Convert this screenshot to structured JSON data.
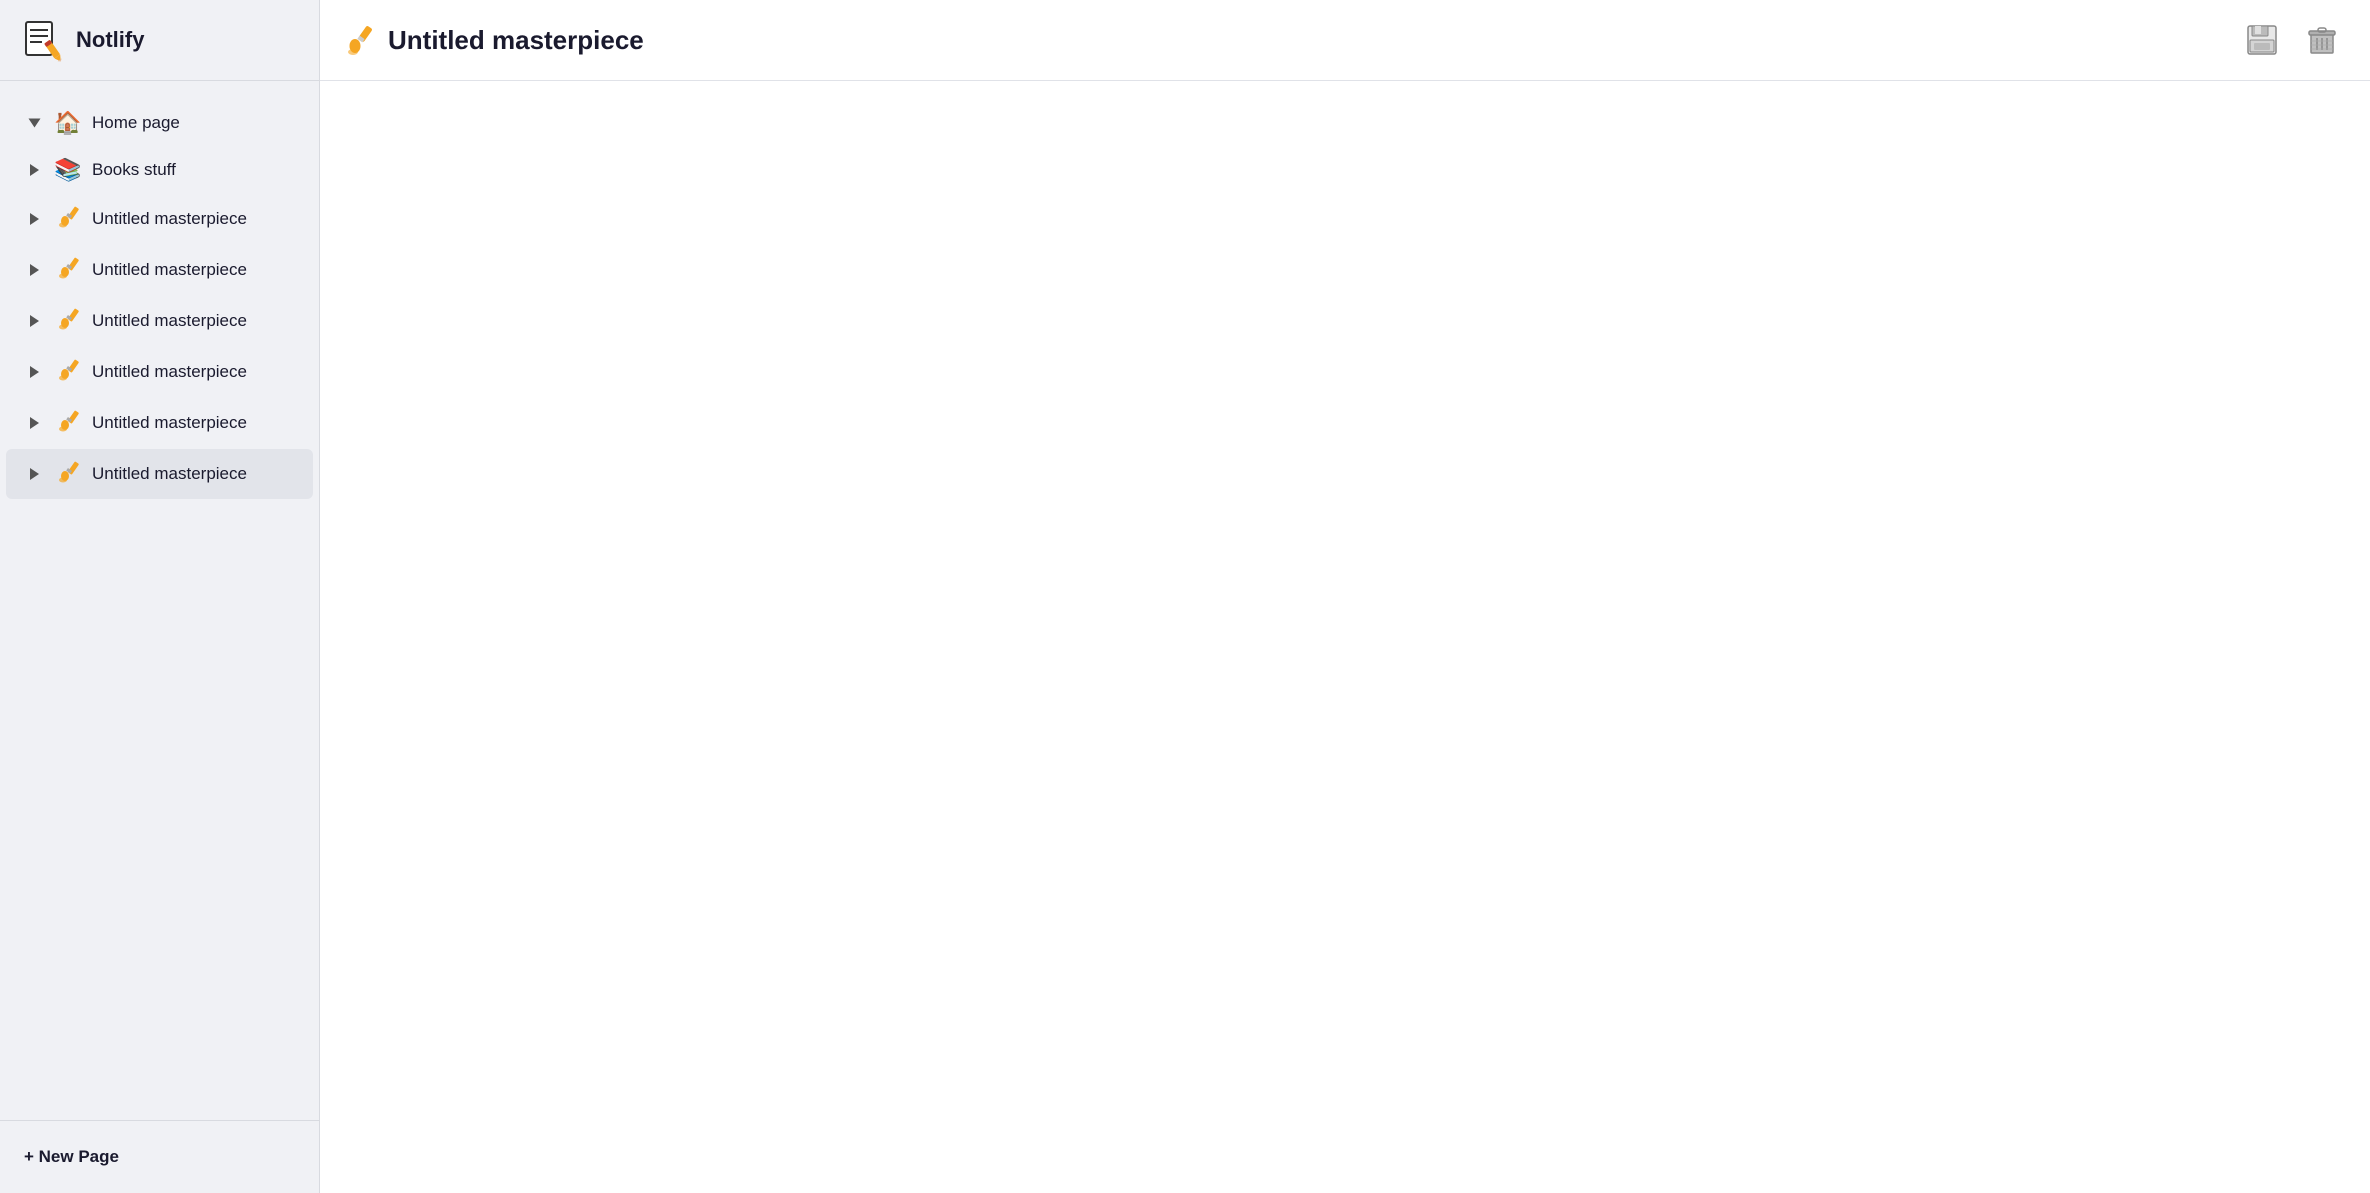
{
  "app": {
    "title": "Notlify",
    "logo_alt": "notlify-logo"
  },
  "sidebar": {
    "nav_items": [
      {
        "id": "home",
        "label": "Home page",
        "icon": "🏠",
        "expanded": true,
        "active": false
      },
      {
        "id": "books",
        "label": "Books stuff",
        "icon": "📚",
        "expanded": false,
        "active": false
      },
      {
        "id": "untitled1",
        "label": "Untitled masterpiece",
        "icon": "🖌️",
        "expanded": false,
        "active": false
      },
      {
        "id": "untitled2",
        "label": "Untitled masterpiece",
        "icon": "🖌️",
        "expanded": false,
        "active": false
      },
      {
        "id": "untitled3",
        "label": "Untitled masterpiece",
        "icon": "🖌️",
        "expanded": false,
        "active": false
      },
      {
        "id": "untitled4",
        "label": "Untitled masterpiece",
        "icon": "🖌️",
        "expanded": false,
        "active": false
      },
      {
        "id": "untitled5",
        "label": "Untitled masterpiece",
        "icon": "🖌️",
        "expanded": false,
        "active": false
      },
      {
        "id": "untitled6",
        "label": "Untitled masterpiece",
        "icon": "🖌️",
        "expanded": false,
        "active": true
      }
    ],
    "new_page_label": "+ New Page"
  },
  "main": {
    "title": "Untitled masterpiece",
    "title_icon": "🖌️",
    "save_button_title": "Save",
    "delete_button_title": "Delete"
  }
}
